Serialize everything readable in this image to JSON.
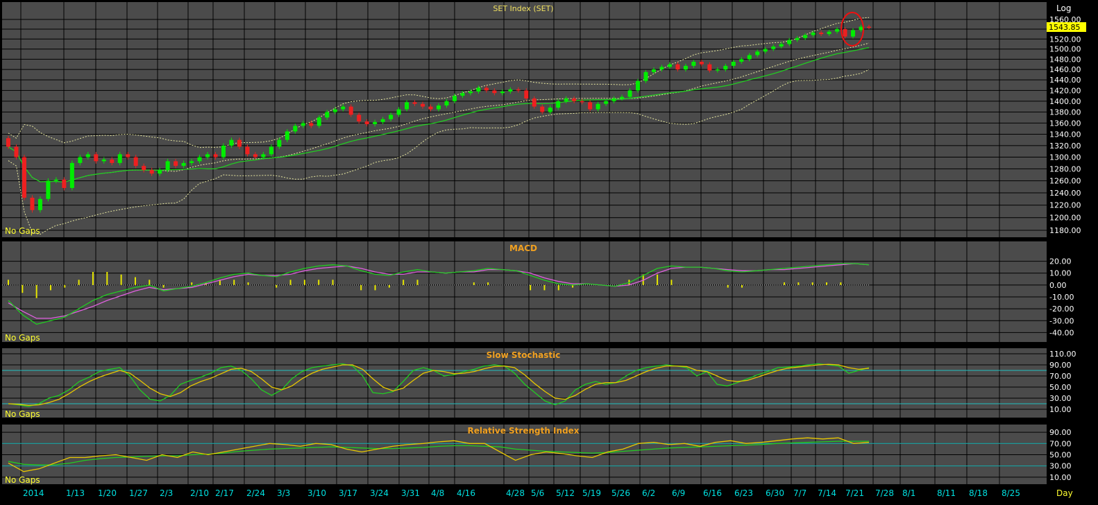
{
  "colors": {
    "background": "#000000",
    "panel": "#4b4b4b",
    "grid": "#000000",
    "up_candle": "#00ee00",
    "down_candle": "#ee2020",
    "bollinger": "#e8e8a0",
    "moving_average": "#22cc22",
    "macd_line": "#22cc22",
    "signal_line": "#e060e0",
    "histogram": "#e8e800",
    "stoch_k": "#22cc22",
    "stoch_d": "#e8c800",
    "rsi": "#e8c800",
    "rsi_ma": "#22cc22",
    "ref_lines": "#20c0c0",
    "panel_title_orange": "#f0a020",
    "price_title": "#f0e060",
    "axis_text": "#ffffff",
    "date_text": "#00e0e0",
    "price_box": "#ffff00",
    "circle": "#ee1010"
  },
  "labels": {
    "price_title": "SET Index (SET)",
    "macd_title": "MACD",
    "stoch_title": "Slow Stochastic",
    "rsi_title": "Relative Strength Index",
    "no_gaps": "No Gaps",
    "scale": "Log",
    "current_price": "1543.85",
    "period": "Day"
  },
  "chart_data": [
    {
      "type": "candlestick",
      "title": "SET Index (SET)",
      "scale": "log",
      "ylim": [
        1180,
        1560
      ],
      "ticks": [
        "1180.00",
        "1200.00",
        "1220.00",
        "1240.00",
        "1260.00",
        "1280.00",
        "1300.00",
        "1320.00",
        "1340.00",
        "1360.00",
        "1380.00",
        "1400.00",
        "1420.00",
        "1440.00",
        "1460.00",
        "1480.00",
        "1500.00",
        "1520.00",
        "1540.00",
        "1560.00"
      ],
      "last_price": "1543.85",
      "x_labels": [
        "2014",
        "1/13",
        "1/20",
        "1/27",
        "2/3",
        "2/10",
        "2/17",
        "2/24",
        "3/3",
        "3/10",
        "3/17",
        "3/24",
        "3/31",
        "4/8",
        "4/16",
        "4/28",
        "5/6",
        "5/12",
        "5/19",
        "5/26",
        "6/2",
        "6/9",
        "6/16",
        "6/23",
        "6/30",
        "7/7",
        "7/14",
        "7/21",
        "7/28",
        "8/1",
        "8/11",
        "8/18",
        "8/25"
      ],
      "close": [
        1318,
        1300,
        1232,
        1212,
        1230,
        1260,
        1262,
        1248,
        1290,
        1300,
        1305,
        1293,
        1296,
        1290,
        1305,
        1300,
        1285,
        1278,
        1272,
        1278,
        1293,
        1285,
        1290,
        1293,
        1300,
        1305,
        1300,
        1320,
        1330,
        1318,
        1305,
        1300,
        1305,
        1318,
        1330,
        1345,
        1355,
        1360,
        1355,
        1370,
        1380,
        1385,
        1390,
        1375,
        1363,
        1358,
        1362,
        1367,
        1375,
        1385,
        1398,
        1395,
        1390,
        1385,
        1392,
        1400,
        1410,
        1415,
        1418,
        1425,
        1420,
        1415,
        1418,
        1422,
        1420,
        1405,
        1390,
        1380,
        1388,
        1400,
        1405,
        1400,
        1398,
        1385,
        1395,
        1400,
        1405,
        1408,
        1420,
        1438,
        1455,
        1460,
        1465,
        1470,
        1460,
        1467,
        1475,
        1470,
        1458,
        1460,
        1467,
        1475,
        1480,
        1488,
        1495,
        1500,
        1505,
        1510,
        1518,
        1522,
        1528,
        1533,
        1530,
        1535,
        1540,
        1525,
        1538,
        1545,
        1543.85
      ],
      "stoch_k": [
        20,
        18,
        15,
        20,
        30,
        35,
        45,
        60,
        68,
        78,
        82,
        85,
        70,
        45,
        28,
        25,
        35,
        55,
        62,
        68,
        75,
        85,
        88,
        80,
        65,
        45,
        35,
        45,
        65,
        78,
        85,
        88,
        90,
        92,
        88,
        70,
        40,
        38,
        42,
        60,
        80,
        85,
        80,
        70,
        72,
        78,
        82,
        88,
        90,
        88,
        75,
        55,
        40,
        25,
        18,
        25,
        45,
        55,
        60,
        55,
        58,
        70,
        80,
        85,
        88,
        90,
        88,
        85,
        70,
        78,
        55,
        52,
        58,
        65,
        72,
        78,
        85,
        86,
        88,
        90,
        92,
        90,
        88,
        75,
        80,
        85
      ],
      "stoch_d": [
        20,
        19,
        17,
        18,
        22,
        28,
        38,
        50,
        60,
        68,
        74,
        80,
        75,
        62,
        48,
        38,
        33,
        40,
        52,
        60,
        66,
        74,
        82,
        84,
        78,
        65,
        50,
        45,
        52,
        65,
        75,
        82,
        86,
        90,
        90,
        82,
        65,
        50,
        43,
        48,
        62,
        75,
        80,
        78,
        74,
        75,
        78,
        83,
        87,
        88,
        85,
        72,
        56,
        42,
        30,
        28,
        35,
        46,
        55,
        58,
        58,
        62,
        70,
        78,
        84,
        88,
        88,
        87,
        80,
        78,
        70,
        62,
        60,
        62,
        68,
        74,
        80,
        84,
        86,
        88,
        90,
        91,
        90,
        85,
        82,
        84
      ],
      "stoch_ref": [
        20,
        80
      ],
      "stoch_ticks": [
        "10.00",
        "30.00",
        "50.00",
        "70.00",
        "90.00",
        "110.00"
      ],
      "macd": [
        -13,
        -25,
        -33,
        -30,
        -27,
        -20,
        -13,
        -8,
        -5,
        -2,
        0,
        -5,
        -3,
        -1,
        2,
        6,
        9,
        10,
        8,
        7,
        11,
        14,
        16,
        17,
        16,
        12,
        9,
        8,
        11,
        13,
        11,
        10,
        11,
        12,
        14,
        13,
        12,
        8,
        4,
        1,
        0,
        1,
        0,
        -1,
        2,
        8,
        14,
        16,
        15,
        15,
        14,
        12,
        11,
        12,
        13,
        14,
        15,
        16,
        17,
        18,
        18,
        17
      ],
      "signal": [
        -15,
        -22,
        -28,
        -28,
        -26,
        -22,
        -18,
        -13,
        -9,
        -5,
        -2,
        -4,
        -3,
        -2,
        1,
        4,
        7,
        9,
        8,
        8,
        9,
        12,
        14,
        15,
        16,
        14,
        11,
        9,
        9,
        11,
        11,
        10,
        11,
        11,
        13,
        13,
        12,
        10,
        6,
        3,
        1,
        1,
        0,
        -1,
        0,
        4,
        10,
        14,
        15,
        15,
        14,
        13,
        12,
        12,
        13,
        13,
        14,
        15,
        16,
        17,
        18,
        17
      ],
      "macd_ticks": [
        "-40.00",
        "-30.00",
        "-20.00",
        "-10.00",
        "0.00",
        "10.00",
        "20.00"
      ],
      "rsi": [
        35,
        20,
        25,
        35,
        45,
        45,
        48,
        50,
        45,
        40,
        50,
        45,
        55,
        50,
        55,
        60,
        65,
        70,
        68,
        65,
        70,
        68,
        60,
        55,
        60,
        65,
        68,
        70,
        73,
        75,
        70,
        70,
        55,
        40,
        50,
        55,
        52,
        48,
        45,
        55,
        60,
        70,
        72,
        68,
        70,
        65,
        72,
        75,
        70,
        72,
        75,
        78,
        80,
        78,
        80,
        70,
        72
      ],
      "rsi_ma": [
        38,
        33,
        32,
        32,
        35,
        40,
        43,
        45,
        46,
        47,
        48,
        48,
        50,
        51,
        53,
        56,
        58,
        60,
        61,
        62,
        63,
        64,
        63,
        62,
        61,
        61,
        62,
        63,
        65,
        66,
        66,
        65,
        64,
        60,
        58,
        56,
        55,
        54,
        53,
        54,
        56,
        58,
        60,
        62,
        63,
        64,
        65,
        66,
        67,
        68,
        70,
        71,
        72,
        73,
        74,
        74,
        74
      ],
      "rsi_ref": [
        30,
        70
      ],
      "rsi_ticks": [
        "10.00",
        "30.00",
        "50.00",
        "70.00",
        "90.00"
      ]
    }
  ]
}
